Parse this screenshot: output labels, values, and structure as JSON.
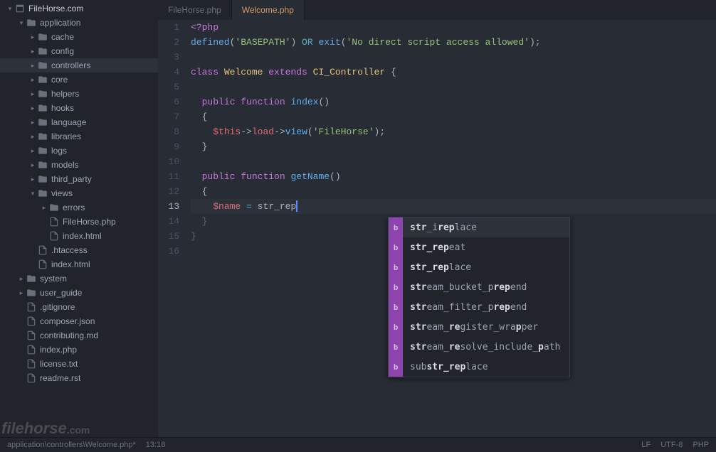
{
  "tree": [
    {
      "depth": 0,
      "arrow": "down",
      "icon": "repo",
      "label": "FileHorse.com",
      "cls": "root"
    },
    {
      "depth": 1,
      "arrow": "down",
      "icon": "folder",
      "label": "application",
      "cls": "folder"
    },
    {
      "depth": 2,
      "arrow": "right",
      "icon": "folder",
      "label": "cache",
      "cls": "folder"
    },
    {
      "depth": 2,
      "arrow": "right",
      "icon": "folder",
      "label": "config",
      "cls": "folder"
    },
    {
      "depth": 2,
      "arrow": "right",
      "icon": "folder",
      "label": "controllers",
      "cls": "folder selected mod"
    },
    {
      "depth": 2,
      "arrow": "right",
      "icon": "folder",
      "label": "core",
      "cls": "folder"
    },
    {
      "depth": 2,
      "arrow": "right",
      "icon": "folder",
      "label": "helpers",
      "cls": "folder"
    },
    {
      "depth": 2,
      "arrow": "right",
      "icon": "folder",
      "label": "hooks",
      "cls": "folder"
    },
    {
      "depth": 2,
      "arrow": "right",
      "icon": "folder",
      "label": "language",
      "cls": "folder"
    },
    {
      "depth": 2,
      "arrow": "right",
      "icon": "folder",
      "label": "libraries",
      "cls": "folder"
    },
    {
      "depth": 2,
      "arrow": "right",
      "icon": "folder",
      "label": "logs",
      "cls": "folder"
    },
    {
      "depth": 2,
      "arrow": "right",
      "icon": "folder",
      "label": "models",
      "cls": "folder"
    },
    {
      "depth": 2,
      "arrow": "right",
      "icon": "folder",
      "label": "third_party",
      "cls": "folder"
    },
    {
      "depth": 2,
      "arrow": "down",
      "icon": "folder",
      "label": "views",
      "cls": "folder"
    },
    {
      "depth": 3,
      "arrow": "right",
      "icon": "folder",
      "label": "errors",
      "cls": "folder"
    },
    {
      "depth": 3,
      "arrow": "",
      "icon": "file",
      "label": "FileHorse.php",
      "cls": ""
    },
    {
      "depth": 3,
      "arrow": "",
      "icon": "file",
      "label": "index.html",
      "cls": ""
    },
    {
      "depth": 2,
      "arrow": "",
      "icon": "file",
      "label": ".htaccess",
      "cls": ""
    },
    {
      "depth": 2,
      "arrow": "",
      "icon": "file",
      "label": "index.html",
      "cls": ""
    },
    {
      "depth": 1,
      "arrow": "right",
      "icon": "folder",
      "label": "system",
      "cls": "folder"
    },
    {
      "depth": 1,
      "arrow": "right",
      "icon": "folder",
      "label": "user_guide",
      "cls": "folder"
    },
    {
      "depth": 1,
      "arrow": "",
      "icon": "file",
      "label": ".gitignore",
      "cls": ""
    },
    {
      "depth": 1,
      "arrow": "",
      "icon": "file",
      "label": "composer.json",
      "cls": ""
    },
    {
      "depth": 1,
      "arrow": "",
      "icon": "file",
      "label": "contributing.md",
      "cls": ""
    },
    {
      "depth": 1,
      "arrow": "",
      "icon": "file",
      "label": "index.php",
      "cls": ""
    },
    {
      "depth": 1,
      "arrow": "",
      "icon": "file",
      "label": "license.txt",
      "cls": ""
    },
    {
      "depth": 1,
      "arrow": "",
      "icon": "file",
      "label": "readme.rst",
      "cls": ""
    }
  ],
  "tabs": [
    {
      "label": "FileHorse.php",
      "active": false,
      "mod": false
    },
    {
      "label": "Welcome.php",
      "active": true,
      "mod": true
    }
  ],
  "code": {
    "lines": [
      {
        "n": 1,
        "tokens": [
          [
            "<?php",
            "t-keyword"
          ]
        ]
      },
      {
        "n": 2,
        "tokens": [
          [
            "defined",
            "t-func"
          ],
          [
            "(",
            "t-default"
          ],
          [
            "'BASEPATH'",
            "t-string"
          ],
          [
            ") ",
            "t-default"
          ],
          [
            "OR",
            "t-op"
          ],
          [
            " ",
            "t-default"
          ],
          [
            "exit",
            "t-func"
          ],
          [
            "(",
            "t-default"
          ],
          [
            "'No direct script access allowed'",
            "t-string"
          ],
          [
            ");",
            "t-default"
          ]
        ]
      },
      {
        "n": 3,
        "tokens": []
      },
      {
        "n": 4,
        "tokens": [
          [
            "class",
            "t-keyword"
          ],
          [
            " ",
            "t-default"
          ],
          [
            "Welcome",
            "t-class"
          ],
          [
            " ",
            "t-default"
          ],
          [
            "extends",
            "t-keyword"
          ],
          [
            " ",
            "t-default"
          ],
          [
            "CI_Controller",
            "t-class"
          ],
          [
            " {",
            "t-default"
          ]
        ]
      },
      {
        "n": 5,
        "tokens": []
      },
      {
        "n": 6,
        "tokens": [
          [
            "  ",
            "t-default"
          ],
          [
            "public",
            "t-keyword"
          ],
          [
            " ",
            "t-default"
          ],
          [
            "function",
            "t-keyword"
          ],
          [
            " ",
            "t-default"
          ],
          [
            "index",
            "t-func"
          ],
          [
            "()",
            "t-default"
          ]
        ]
      },
      {
        "n": 7,
        "tokens": [
          [
            "  {",
            "t-default"
          ]
        ]
      },
      {
        "n": 8,
        "tokens": [
          [
            "    ",
            "t-default"
          ],
          [
            "$this",
            "t-this"
          ],
          [
            "->",
            "t-default"
          ],
          [
            "load",
            "t-var"
          ],
          [
            "->",
            "t-default"
          ],
          [
            "view",
            "t-func"
          ],
          [
            "(",
            "t-default"
          ],
          [
            "'FileHorse'",
            "t-string"
          ],
          [
            ");",
            "t-default"
          ]
        ]
      },
      {
        "n": 9,
        "tokens": [
          [
            "  }",
            "t-default"
          ]
        ]
      },
      {
        "n": 10,
        "tokens": []
      },
      {
        "n": 11,
        "tokens": [
          [
            "  ",
            "t-default"
          ],
          [
            "public",
            "t-keyword"
          ],
          [
            " ",
            "t-default"
          ],
          [
            "function",
            "t-keyword"
          ],
          [
            " ",
            "t-default"
          ],
          [
            "getName",
            "t-func"
          ],
          [
            "()",
            "t-default"
          ]
        ]
      },
      {
        "n": 12,
        "tokens": [
          [
            "  {",
            "t-default"
          ]
        ]
      },
      {
        "n": 13,
        "current": true,
        "tokens": [
          [
            "    ",
            "t-default"
          ],
          [
            "$name",
            "t-var"
          ],
          [
            " ",
            "t-default"
          ],
          [
            "=",
            "t-op"
          ],
          [
            " ",
            "t-default"
          ],
          [
            "str_rep",
            "t-default"
          ],
          [
            "|CURSOR|",
            ""
          ]
        ]
      },
      {
        "n": 14,
        "tokens": [
          [
            "  }",
            "t-pale"
          ]
        ]
      },
      {
        "n": 15,
        "tokens": [
          [
            "}",
            "t-pale"
          ]
        ]
      },
      {
        "n": 16,
        "tokens": []
      }
    ]
  },
  "autocomplete": {
    "badge": "b",
    "items": [
      {
        "selected": true,
        "parts": [
          [
            "str",
            "1"
          ],
          [
            "_i",
            "0"
          ],
          [
            "rep",
            "1"
          ],
          [
            "lace",
            "0"
          ]
        ]
      },
      {
        "parts": [
          [
            "str_rep",
            "1"
          ],
          [
            "eat",
            "0"
          ]
        ]
      },
      {
        "parts": [
          [
            "str_rep",
            "1"
          ],
          [
            "lace",
            "0"
          ]
        ]
      },
      {
        "parts": [
          [
            "str",
            "1"
          ],
          [
            "eam_bucket_p",
            "0"
          ],
          [
            "rep",
            "1"
          ],
          [
            "end",
            "0"
          ]
        ]
      },
      {
        "parts": [
          [
            "str",
            "1"
          ],
          [
            "eam_filter_p",
            "0"
          ],
          [
            "rep",
            "1"
          ],
          [
            "end",
            "0"
          ]
        ]
      },
      {
        "parts": [
          [
            "str",
            "1"
          ],
          [
            "eam_",
            "0"
          ],
          [
            "re",
            "1"
          ],
          [
            "gister_wra",
            "0"
          ],
          [
            "p",
            "1"
          ],
          [
            "per",
            "0"
          ]
        ]
      },
      {
        "parts": [
          [
            "str",
            "1"
          ],
          [
            "eam_",
            "0"
          ],
          [
            "re",
            "1"
          ],
          [
            "solve_include_",
            "0"
          ],
          [
            "p",
            "1"
          ],
          [
            "ath",
            "0"
          ]
        ]
      },
      {
        "parts": [
          [
            "sub",
            "0"
          ],
          [
            "str_rep",
            "1"
          ],
          [
            "lace",
            "0"
          ]
        ]
      }
    ]
  },
  "statusbar": {
    "path": "application\\controllers\\Welcome.php*",
    "pos": "13:18",
    "eol": "LF",
    "encoding": "UTF-8",
    "lang": "PHP"
  },
  "watermark": {
    "brand": "filehorse",
    "tld": ".com"
  }
}
